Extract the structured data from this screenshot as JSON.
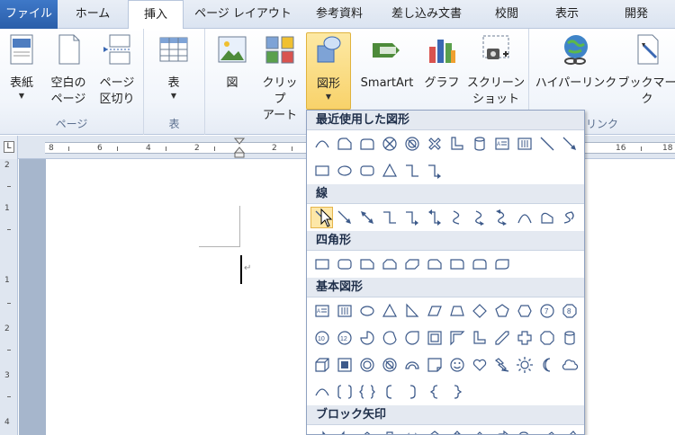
{
  "tabs": [
    "ファイル",
    "ホーム",
    "挿入",
    "ページ レイアウト",
    "参考資料",
    "差し込み文書",
    "校閲",
    "表示",
    "開発"
  ],
  "active_tab": "挿入",
  "ribbon": {
    "groups": [
      {
        "label": "ページ",
        "buttons": [
          [
            "表紙"
          ],
          [
            "空白の",
            "ページ"
          ],
          [
            "ページ",
            "区切り"
          ]
        ]
      },
      {
        "label": "表",
        "buttons": [
          [
            "表"
          ]
        ]
      },
      {
        "label": "",
        "buttons": [
          [
            "図"
          ],
          [
            "クリップ",
            "アート"
          ],
          [
            "図形"
          ],
          [
            "SmartArt"
          ],
          [
            "グラフ"
          ],
          [
            "スクリーン",
            "ショット"
          ]
        ]
      },
      {
        "label": "リンク",
        "buttons": [
          [
            "ハイパーリンク"
          ],
          [
            "ブックマーク"
          ]
        ]
      }
    ]
  },
  "ruler": {
    "labels": [
      "8",
      "6",
      "4",
      "2",
      "2",
      "4",
      "16",
      "18"
    ]
  },
  "vruler": {
    "labels": [
      "2",
      "1",
      "1",
      "2",
      "3",
      "4"
    ]
  },
  "dropdown": {
    "sections": [
      {
        "title": "最近使用した図形",
        "shapes": [
          [
            "arc",
            "round-tri-rect",
            "snip-rect",
            "circle-x",
            "no-symbol",
            "multiply",
            "l-shape",
            "can",
            "textbox",
            "vtextbox",
            "line",
            "arrow"
          ],
          [
            "rect",
            "oval",
            "round-rect",
            "triangle",
            "elbow",
            "elbow-arrow"
          ]
        ]
      },
      {
        "title": "線",
        "shapes": [
          [
            "line",
            "arrow",
            "double-arrow",
            "elbow",
            "elbow-arrow",
            "elbow-double-arrow",
            "curve",
            "curved-arrow",
            "curved-double-arrow",
            "arc-curve",
            "freeform",
            "scribble"
          ]
        ]
      },
      {
        "title": "四角形",
        "shapes": [
          [
            "rect",
            "round-rect",
            "snip1",
            "snip2",
            "snip-diag",
            "snip-round",
            "round1",
            "round2",
            "round-diag"
          ]
        ]
      },
      {
        "title": "基本図形",
        "shapes": [
          [
            "textbox",
            "vtextbox",
            "oval",
            "triangle",
            "right-triangle",
            "parallelogram",
            "trapezoid",
            "diamond",
            "pentagon",
            "hexagon",
            "num7",
            "num8"
          ],
          [
            "num10",
            "num12",
            "pie",
            "chord",
            "teardrop",
            "frame",
            "half-frame",
            "l-shape",
            "diag-stripe",
            "cross",
            "octagon",
            "can"
          ],
          [
            "cube",
            "bevel",
            "donut",
            "no-symbol",
            "block-arc",
            "folded",
            "smiley",
            "heart",
            "lightning",
            "sun",
            "moon",
            "cloud"
          ],
          [
            "arc",
            "bracket-pair",
            "brace-pair",
            "left-bracket",
            "right-bracket",
            "left-brace",
            "right-brace"
          ]
        ]
      },
      {
        "title": "ブロック矢印",
        "shapes": [
          [
            "right-arrow",
            "left-arrow",
            "up-arrow",
            "down-arrow",
            "lr-arrow",
            "ud-arrow",
            "quad-arrow",
            "lru-arrow",
            "bent-arrow",
            "u-turn",
            "lu-arrow",
            "bent-up-arrow"
          ]
        ]
      }
    ]
  }
}
